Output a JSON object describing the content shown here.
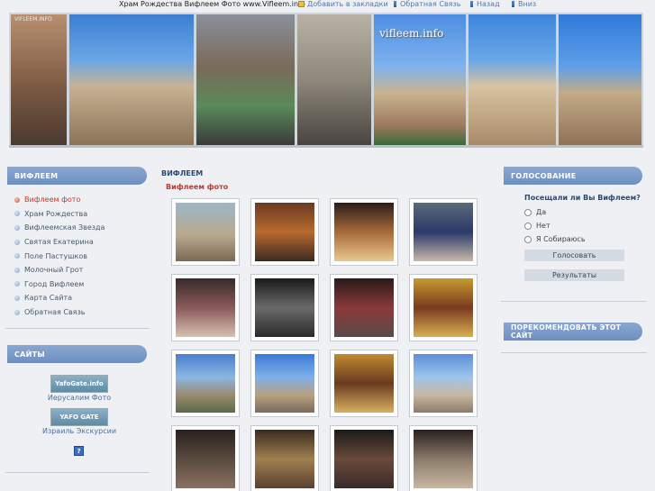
{
  "topbar": {
    "title": "Храм Рождества Вифлеем Фото www.Vifleem.info",
    "links": [
      "Добавить в закладки",
      "Обратная Связь",
      "Назад",
      "Вниз"
    ]
  },
  "banner": {
    "watermark": "vifleem.info",
    "small_watermark": "VIFLEEM.INFO"
  },
  "left": {
    "menu_header": "ВИФЛЕЕМ",
    "menu": [
      "Вифлеем фото",
      "Храм Рождества",
      "Вифлеемская Звезда",
      "Святая Екатерина",
      "Поле Пастушков",
      "Молочный Грот",
      "Город Вифлеем",
      "Карта Сайта",
      "Обратная Связь"
    ],
    "active_index": 0,
    "sites_header": "САЙТЫ",
    "sites": [
      {
        "logo": "YafoGate.info",
        "label": "Иерусалим Фото"
      },
      {
        "logo": "YAFO GATE",
        "label": "Израиль Экскурсии"
      }
    ],
    "badge_icon": "question-icon"
  },
  "center": {
    "title": "ВИФЛЕЕМ",
    "subtitle": "Вифлеем фото",
    "thumbnails": [
      "courtyard-photo",
      "mosaic-columns-photo",
      "candles-altar-photo",
      "priest-photo",
      "visitors-candles-photo",
      "grotto-photo",
      "crowd-photo",
      "icon-madonna-photo",
      "street-photo",
      "church-exterior-photo",
      "iconostasis-photo",
      "chapel-facade-photo",
      "monk-photo",
      "interior-icons-photo",
      "worshippers-photo",
      "cave-interior-photo"
    ]
  },
  "right": {
    "poll_header": "ГОЛОСОВАНИЕ",
    "question": "Посещали ли Вы Вифлеем?",
    "options": [
      "Да",
      "Нет",
      "Я Собираюсь"
    ],
    "vote_button": "Голосовать",
    "results_button": "Результаты",
    "recommend_header": "ПОРЕКОМЕНДОВАТЬ ЭТОТ САЙТ"
  },
  "colors": {
    "header_blue": "#7b9acb",
    "active_red": "#c0392b",
    "background": "#eef0f3"
  }
}
